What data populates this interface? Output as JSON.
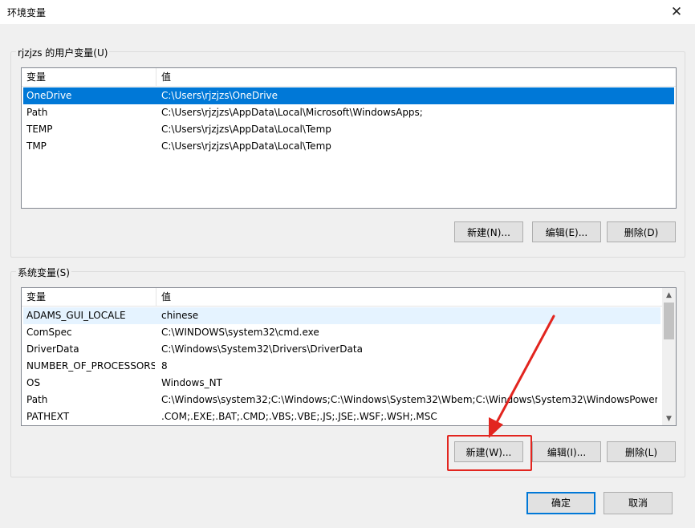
{
  "window": {
    "title": "环境变量",
    "close_glyph": "✕"
  },
  "user_vars": {
    "group_label": "rjzjzs 的用户变量(U)",
    "columns": [
      "变量",
      "值"
    ],
    "rows": [
      {
        "name": "OneDrive",
        "value": "C:\\Users\\rjzjzs\\OneDrive",
        "selected": true
      },
      {
        "name": "Path",
        "value": "C:\\Users\\rjzjzs\\AppData\\Local\\Microsoft\\WindowsApps;"
      },
      {
        "name": "TEMP",
        "value": "C:\\Users\\rjzjzs\\AppData\\Local\\Temp"
      },
      {
        "name": "TMP",
        "value": "C:\\Users\\rjzjzs\\AppData\\Local\\Temp"
      }
    ],
    "new_label": "新建(N)...",
    "edit_label": "编辑(E)...",
    "delete_label": "删除(D)"
  },
  "system_vars": {
    "group_label": "系统变量(S)",
    "columns": [
      "变量",
      "值"
    ],
    "rows": [
      {
        "name": "ADAMS_GUI_LOCALE",
        "value": "chinese",
        "hover": true
      },
      {
        "name": "ComSpec",
        "value": "C:\\WINDOWS\\system32\\cmd.exe"
      },
      {
        "name": "DriverData",
        "value": "C:\\Windows\\System32\\Drivers\\DriverData"
      },
      {
        "name": "NUMBER_OF_PROCESSORS",
        "value": "8"
      },
      {
        "name": "OS",
        "value": "Windows_NT"
      },
      {
        "name": "Path",
        "value": "C:\\Windows\\system32;C:\\Windows;C:\\Windows\\System32\\Wbem;C:\\Windows\\System32\\WindowsPower..."
      },
      {
        "name": "PATHEXT",
        "value": ".COM;.EXE;.BAT;.CMD;.VBS;.VBE;.JS;.JSE;.WSF;.WSH;.MSC"
      }
    ],
    "new_label": "新建(W)...",
    "edit_label": "编辑(I)...",
    "delete_label": "删除(L)"
  },
  "dialog": {
    "ok_label": "确定",
    "cancel_label": "取消"
  },
  "colors": {
    "selection": "#0078d7",
    "annotation": "#e2251f"
  }
}
